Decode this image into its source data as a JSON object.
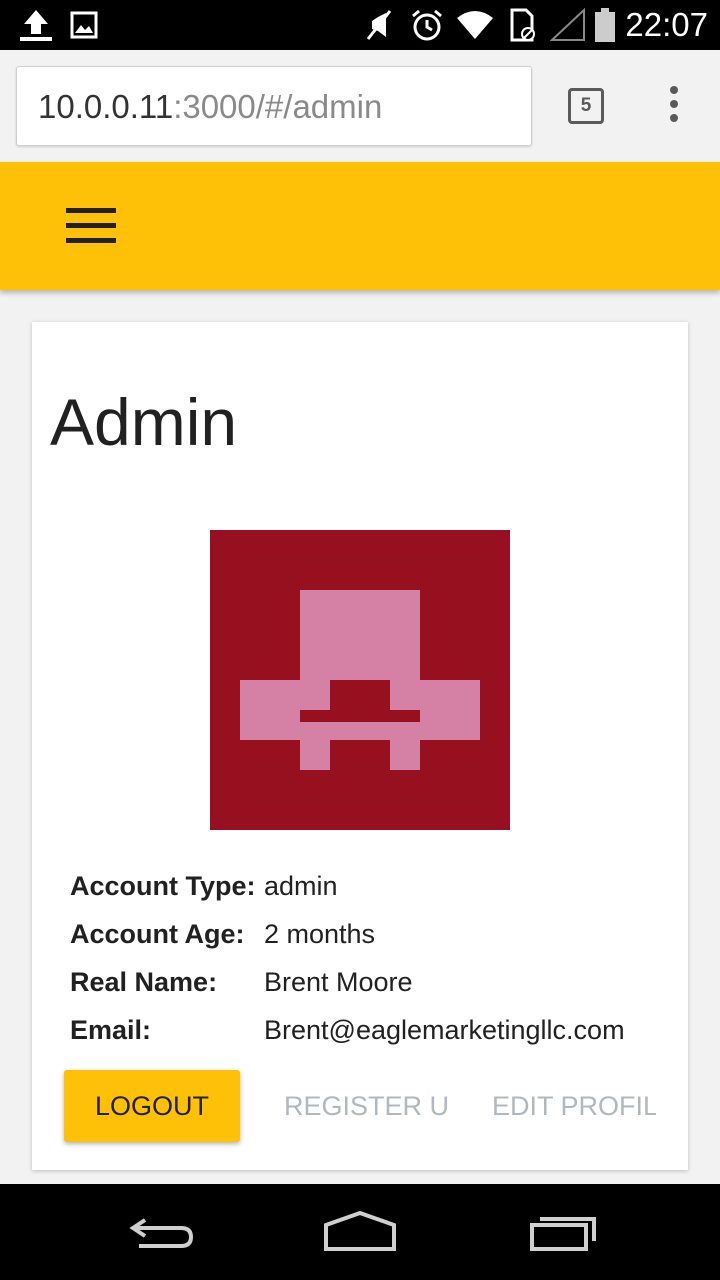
{
  "status_bar": {
    "time": "22:07",
    "icons": [
      "upload-icon",
      "image-icon",
      "mute-icon",
      "alarm-icon",
      "wifi-icon",
      "sim-icon",
      "signal-icon",
      "battery-icon"
    ]
  },
  "browser": {
    "url_host": "10.0.0.11",
    "url_path": ":3000/#/admin",
    "tab_count": "5"
  },
  "app_bar": {
    "color": "#ffc107",
    "menu_icon": "hamburger-icon"
  },
  "card": {
    "title": "Admin",
    "avatar": {
      "background": "#96101f",
      "foreground": "#d581a6"
    },
    "info": [
      {
        "label": "Account Type:",
        "value": "admin"
      },
      {
        "label": "Account Age:",
        "value": "2 months"
      },
      {
        "label": "Real Name:",
        "value": "Brent Moore"
      },
      {
        "label": "Email:",
        "value": "Brent@eaglemarketingllc.com"
      }
    ],
    "buttons": {
      "logout": "LOGOUT",
      "register": "REGISTER USER",
      "edit_profile": "EDIT PROFILE"
    }
  },
  "nav_bar": {
    "icons": [
      "back-icon",
      "home-icon",
      "recents-icon"
    ]
  }
}
